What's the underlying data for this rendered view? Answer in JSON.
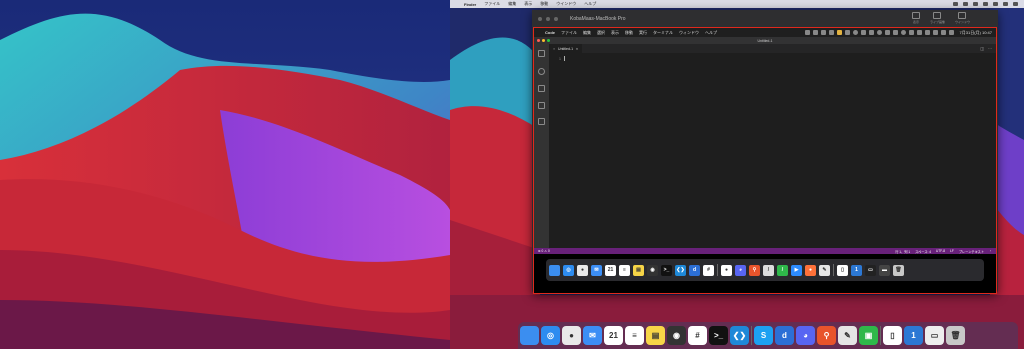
{
  "host_menubar": {
    "apple": "",
    "items": [
      "Finder",
      "ファイル",
      "編集",
      "表示",
      "移動",
      "ウインドウ",
      "ヘルプ"
    ]
  },
  "share_window": {
    "title": "KobaMaas-MacBook Pro",
    "tools": [
      "表示",
      "ライブ画像",
      "ウインドウ"
    ]
  },
  "remote_menubar": {
    "apple": "",
    "items": [
      "Code",
      "ファイル",
      "編集",
      "選択",
      "表示",
      "移動",
      "実行",
      "ターミナル",
      "ウィンドウ",
      "ヘルプ"
    ],
    "clock": "7月31日(月) 10:47"
  },
  "vscode": {
    "window_title": "Untitled-1",
    "tab_label": "Untitled-1",
    "tab_close": "×",
    "line_number": "1",
    "activity_icons": [
      "files-icon",
      "search-icon",
      "source-control-icon",
      "run-debug-icon",
      "extensions-icon",
      "account-icon",
      "settings-gear-icon"
    ],
    "status_left": "⊗ 0 ⚠ 0",
    "status_right": [
      "行 1、列 1",
      "スペース: 4",
      "UTF-8",
      "LF",
      "プレーンテキスト"
    ]
  },
  "remote_dock_apps": [
    {
      "name": "finder",
      "color": "#3b8ef0",
      "glyph": ""
    },
    {
      "name": "safari",
      "color": "#2d8cf0",
      "glyph": "◎"
    },
    {
      "name": "chrome",
      "color": "#e9e9e9",
      "glyph": "●"
    },
    {
      "name": "mail",
      "color": "#3c8ef5",
      "glyph": "✉"
    },
    {
      "name": "calendar",
      "color": "#ffffff",
      "glyph": "21"
    },
    {
      "name": "reminders",
      "color": "#ffffff",
      "glyph": "≡"
    },
    {
      "name": "notes",
      "color": "#f7d547",
      "glyph": "▤"
    },
    {
      "name": "activity",
      "color": "#333333",
      "glyph": "◉"
    },
    {
      "name": "terminal",
      "color": "#111111",
      "glyph": ">_"
    },
    {
      "name": "vscode",
      "color": "#1e88d8",
      "glyph": "❮❯"
    },
    {
      "name": "dict",
      "color": "#2c6fd6",
      "glyph": "d"
    },
    {
      "name": "slack",
      "color": "#ffffff",
      "glyph": "#"
    },
    {
      "name": "sep",
      "color": "",
      "glyph": ""
    },
    {
      "name": "bee",
      "color": "#ffffff",
      "glyph": "●"
    },
    {
      "name": "discord",
      "color": "#5865f2",
      "glyph": "◕"
    },
    {
      "name": "sourcetree",
      "color": "#e8542b",
      "glyph": "⚲"
    },
    {
      "name": "pen",
      "color": "#dddddd",
      "glyph": "/"
    },
    {
      "name": "green-app",
      "color": "#2fb84a",
      "glyph": "/"
    },
    {
      "name": "zoom",
      "color": "#2d8cff",
      "glyph": "▶"
    },
    {
      "name": "firefox",
      "color": "#ff7139",
      "glyph": "●"
    },
    {
      "name": "scripts",
      "color": "#e5e5e5",
      "glyph": "✎"
    },
    {
      "name": "sep",
      "color": "",
      "glyph": ""
    },
    {
      "name": "doc",
      "color": "#ffffff",
      "glyph": "▯"
    },
    {
      "name": "one-pass",
      "color": "#2c78d4",
      "glyph": "1"
    },
    {
      "name": "display",
      "color": "#222222",
      "glyph": "▭"
    },
    {
      "name": "screen",
      "color": "#444444",
      "glyph": "▬"
    },
    {
      "name": "trash",
      "color": "#c8c8c8",
      "glyph": "🗑"
    }
  ],
  "host_dock_apps": [
    {
      "name": "finder",
      "color": "#3b8ef0",
      "glyph": ""
    },
    {
      "name": "safari",
      "color": "#2d8cf0",
      "glyph": "◎"
    },
    {
      "name": "chrome",
      "color": "#e9e9e9",
      "glyph": "●"
    },
    {
      "name": "mail",
      "color": "#3c8ef5",
      "glyph": "✉"
    },
    {
      "name": "calendar",
      "color": "#ffffff",
      "glyph": "21"
    },
    {
      "name": "reminders",
      "color": "#ffffff",
      "glyph": "≡"
    },
    {
      "name": "notes",
      "color": "#f7d547",
      "glyph": "▤"
    },
    {
      "name": "activity",
      "color": "#333333",
      "glyph": "◉"
    },
    {
      "name": "slack",
      "color": "#ffffff",
      "glyph": "#"
    },
    {
      "name": "terminal",
      "color": "#111111",
      "glyph": ">_"
    },
    {
      "name": "vscode",
      "color": "#1e88d8",
      "glyph": "❮❯"
    },
    {
      "name": "sep",
      "color": "",
      "glyph": ""
    },
    {
      "name": "skype",
      "color": "#1da1f2",
      "glyph": "S"
    },
    {
      "name": "dict",
      "color": "#2c6fd6",
      "glyph": "d"
    },
    {
      "name": "discord",
      "color": "#5865f2",
      "glyph": "◕"
    },
    {
      "name": "sourcetree",
      "color": "#e8542b",
      "glyph": "⚲"
    },
    {
      "name": "scripts",
      "color": "#e5e5e5",
      "glyph": "✎"
    },
    {
      "name": "green-app",
      "color": "#2fb84a",
      "glyph": "▣"
    },
    {
      "name": "sep",
      "color": "",
      "glyph": ""
    },
    {
      "name": "doc",
      "color": "#ffffff",
      "glyph": "▯"
    },
    {
      "name": "one-pass",
      "color": "#2c78d4",
      "glyph": "1"
    },
    {
      "name": "display",
      "color": "#eeeeee",
      "glyph": "▭"
    },
    {
      "name": "trash",
      "color": "#c8c8c8",
      "glyph": "🗑"
    }
  ],
  "colors": {
    "share_border": "#e0291d",
    "vscode_status": "#68217a",
    "close_light": "#ff5f57",
    "min_light": "#febc2e",
    "max_light": "#28c840"
  }
}
